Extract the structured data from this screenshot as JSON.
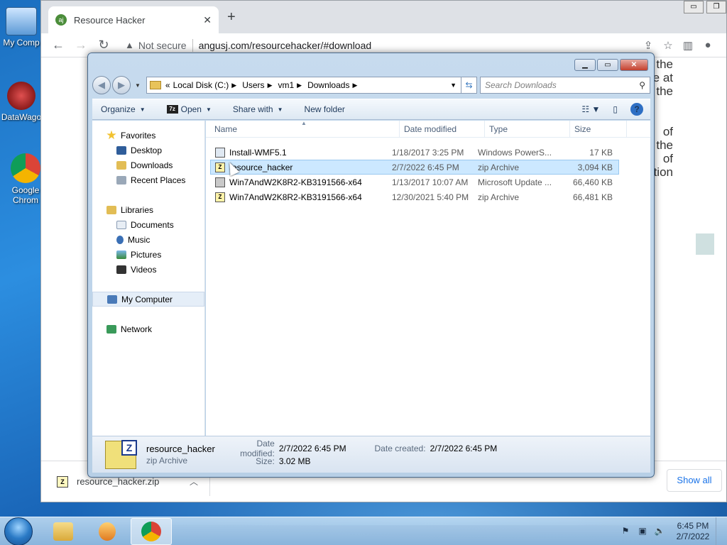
{
  "desktop": {
    "icons": [
      {
        "label": "My Comp"
      },
      {
        "label": "DataWago"
      },
      {
        "label": "Google Chrom"
      }
    ]
  },
  "browser": {
    "tab_title": "Resource Hacker",
    "favicon_text": "aj",
    "new_tab": "+",
    "security_label": "Not secure",
    "url": "angusj.com/resourcehacker/#download",
    "page_fragments": [
      "the",
      "e at",
      "the",
      "of",
      "the",
      "of",
      "tion"
    ],
    "download": {
      "filename": "resource_hacker.zip",
      "show_all": "Show all"
    }
  },
  "explorer": {
    "breadcrumbs": [
      "Local Disk (C:)",
      "Users",
      "vm1",
      "Downloads"
    ],
    "search_placeholder": "Search Downloads",
    "commands": {
      "organize": "Organize",
      "open": "Open",
      "share_with": "Share with",
      "new_folder": "New folder"
    },
    "nav": {
      "favorites_header": "Favorites",
      "favorites": [
        "Desktop",
        "Downloads",
        "Recent Places"
      ],
      "libraries_header": "Libraries",
      "libraries": [
        "Documents",
        "Music",
        "Pictures",
        "Videos"
      ],
      "computer": "My Computer",
      "network": "Network"
    },
    "columns": {
      "name": "Name",
      "date": "Date modified",
      "type": "Type",
      "size": "Size"
    },
    "files": [
      {
        "name": "Install-WMF5.1",
        "date": "1/18/2017 3:25 PM",
        "type": "Windows PowerS...",
        "size": "17 KB",
        "icon": "powershell-icon",
        "selected": false
      },
      {
        "name": "resource_hacker",
        "date": "2/7/2022 6:45 PM",
        "type": "zip Archive",
        "size": "3,094 KB",
        "icon": "zip-icon",
        "selected": true
      },
      {
        "name": "Win7AndW2K8R2-KB3191566-x64",
        "date": "1/13/2017 10:07 AM",
        "type": "Microsoft Update ...",
        "size": "66,460 KB",
        "icon": "msu-icon",
        "selected": false
      },
      {
        "name": "Win7AndW2K8R2-KB3191566-x64",
        "date": "12/30/2021 5:40 PM",
        "type": "zip Archive",
        "size": "66,481 KB",
        "icon": "zip-icon",
        "selected": false
      }
    ],
    "details": {
      "name": "resource_hacker",
      "type": "zip Archive",
      "modified_label": "Date modified:",
      "modified": "2/7/2022 6:45 PM",
      "created_label": "Date created:",
      "created": "2/7/2022 6:45 PM",
      "size_label": "Size:",
      "size": "3.02 MB"
    }
  },
  "taskbar": {
    "time": "6:45 PM",
    "date": "2/7/2022"
  }
}
